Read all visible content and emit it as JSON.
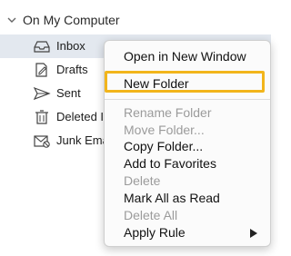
{
  "sidebar": {
    "section_title": "On My Computer",
    "items": [
      {
        "label": "Inbox",
        "icon": "inbox-icon"
      },
      {
        "label": "Drafts",
        "icon": "drafts-icon"
      },
      {
        "label": "Sent",
        "icon": "sent-icon"
      },
      {
        "label": "Deleted I",
        "icon": "trash-icon"
      },
      {
        "label": "Junk Ema",
        "icon": "junk-icon"
      }
    ]
  },
  "context_menu": {
    "items": [
      {
        "label": "Open in New Window",
        "enabled": true
      },
      {
        "label": "New Folder",
        "enabled": true,
        "highlighted": true
      },
      {
        "label": "Rename Folder",
        "enabled": false
      },
      {
        "label": "Move Folder...",
        "enabled": false
      },
      {
        "label": "Copy Folder...",
        "enabled": true
      },
      {
        "label": "Add to Favorites",
        "enabled": true
      },
      {
        "label": "Delete",
        "enabled": false
      },
      {
        "label": "Mark All as Read",
        "enabled": true
      },
      {
        "label": "Delete All",
        "enabled": false
      },
      {
        "label": "Apply Rule",
        "enabled": true,
        "has_submenu": true
      }
    ]
  },
  "colors": {
    "highlight_border": "#f2b51b",
    "selected_row": "#e3e8ef",
    "disabled_text": "#9b9b9b"
  }
}
